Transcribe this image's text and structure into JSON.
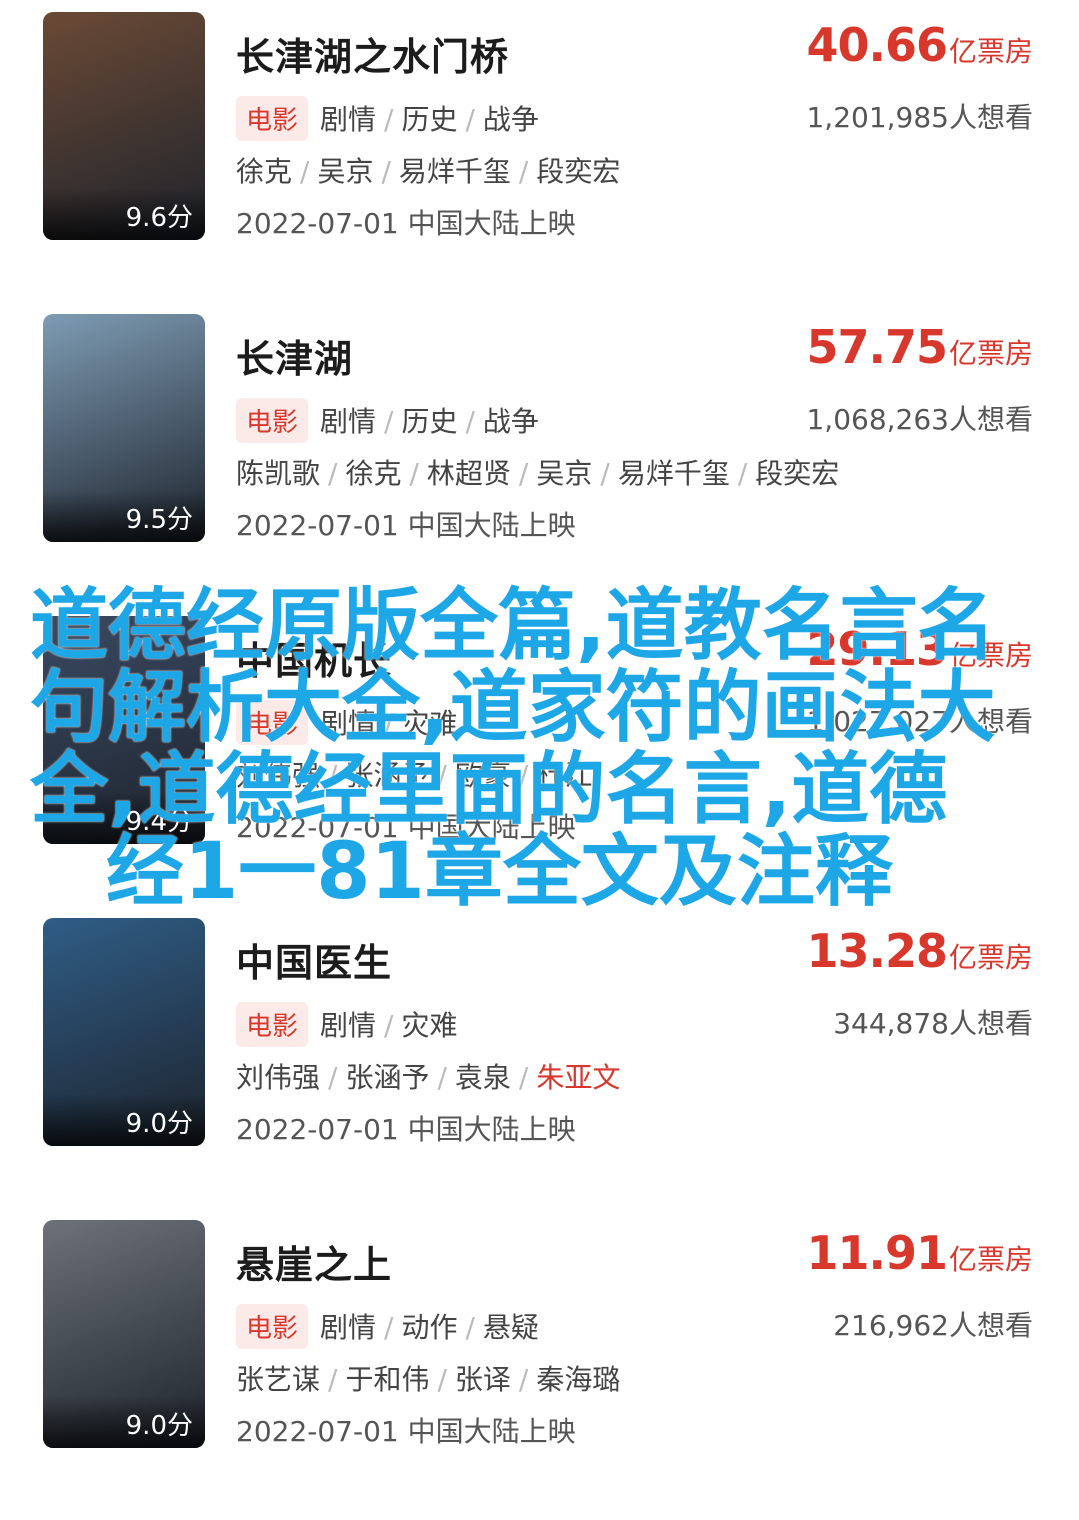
{
  "genre_tag": "电影",
  "box_unit": "亿票房",
  "movies": [
    {
      "title": "长津湖之水门桥",
      "box": "40.66",
      "want": "1,201,985人想看",
      "genres": [
        "剧情",
        "历史",
        "战争"
      ],
      "cast": [
        "徐克",
        "吴京",
        "易烊千玺",
        "段奕宏"
      ],
      "date": "2022-07-01 中国大陆上映",
      "score": "9.6分",
      "poster_color": "#6b4a35"
    },
    {
      "title": "长津湖",
      "box": "57.75",
      "want": "1,068,263人想看",
      "genres": [
        "剧情",
        "历史",
        "战争"
      ],
      "cast": [
        "陈凯歌",
        "徐克",
        "林超贤",
        "吴京",
        "易烊千玺",
        "段奕宏"
      ],
      "date": "2022-07-01 中国大陆上映",
      "score": "9.5分",
      "poster_color": "#7e9cb4"
    },
    {
      "title": "中国机长",
      "box": "29.13",
      "want": "1,027,027人想看",
      "genres": [
        "剧情",
        "灾难"
      ],
      "cast": [
        "刘伟强",
        "张涵予",
        "欧豪",
        "杜江"
      ],
      "date": "2022-07-01 中国大陆上映",
      "score": "9.4分",
      "poster_color": "#3a4a63"
    },
    {
      "title": "中国医生",
      "box": "13.28",
      "want": "344,878人想看",
      "genres": [
        "剧情",
        "灾难"
      ],
      "cast": [
        "刘伟强",
        "张涵予",
        "袁泉",
        "朱亚文"
      ],
      "cast_highlight_last": true,
      "date": "2022-07-01 中国大陆上映",
      "score": "9.0分",
      "poster_color": "#2f5d86"
    },
    {
      "title": "悬崖之上",
      "box": "11.91",
      "want": "216,962人想看",
      "genres": [
        "剧情",
        "动作",
        "悬疑"
      ],
      "cast": [
        "张艺谋",
        "于和伟",
        "张译",
        "秦海璐"
      ],
      "date": "2022-07-01 中国大陆上映",
      "score": "9.0分",
      "poster_color": "#6d7279"
    }
  ],
  "overlay": {
    "line1": "道德经原版全篇,道教名言名",
    "line2": "句解析大全,道家符的画法大",
    "line3": "全,道德经里面的名言,道德",
    "line4": "经1一81章全文及注释"
  }
}
